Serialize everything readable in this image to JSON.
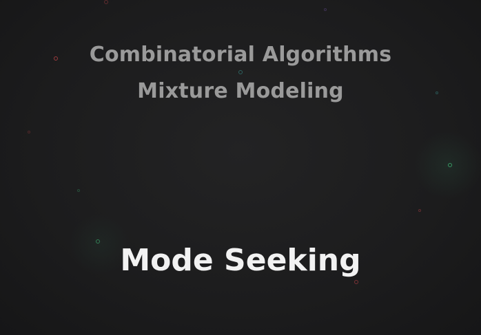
{
  "slide": {
    "line1": "Combinatorial Algorithms",
    "line2": "Mixture Modeling",
    "title": "Mode Seeking"
  },
  "colors": {
    "background": "#1d1d1e",
    "subtitle_text": "#9a9a9a",
    "title_text": "#f2f2f2",
    "particle_red": "#c8464a",
    "particle_green": "#3fbf7a",
    "particle_teal": "#3ba6a0"
  }
}
